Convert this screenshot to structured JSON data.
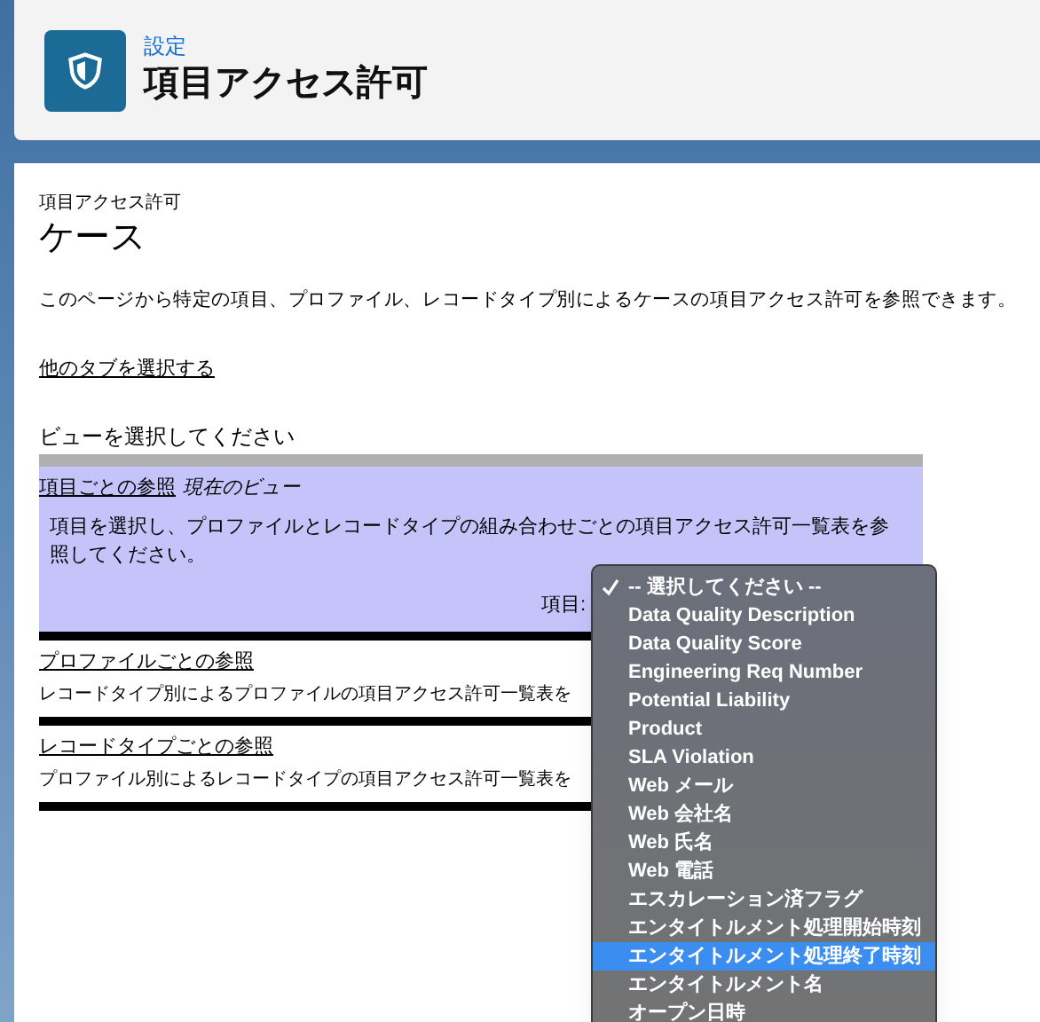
{
  "header": {
    "breadcrumb": "設定",
    "title": "項目アクセス許可"
  },
  "page": {
    "subtitle": "項目アクセス許可",
    "title": "ケース",
    "description": "このページから特定の項目、プロファイル、レコードタイプ別によるケースの項目アクセス許可を参照できます。",
    "tab_link": "他のタブを選択する",
    "view_prompt": "ビューを選択してください"
  },
  "views": [
    {
      "link": "項目ごとの参照",
      "current_label": "現在のビュー",
      "selected": true,
      "description": "項目を選択し、プロファイルとレコードタイプの組み合わせごとの項目アクセス許可一覧表を参照してください。",
      "field_label": "項目:"
    },
    {
      "link": "プロファイルごとの参照",
      "selected": false,
      "description": "レコードタイプ別によるプロファイルの項目アクセス許可一覧表を"
    },
    {
      "link": "レコードタイプごとの参照",
      "selected": false,
      "description": "プロファイル別によるレコードタイプの項目アクセス許可一覧表を"
    }
  ],
  "dropdown": {
    "options": [
      {
        "label": "-- 選択してください --",
        "checked": true,
        "highlighted": false
      },
      {
        "label": "Data Quality Description",
        "checked": false,
        "highlighted": false
      },
      {
        "label": "Data Quality Score",
        "checked": false,
        "highlighted": false
      },
      {
        "label": "Engineering Req Number",
        "checked": false,
        "highlighted": false
      },
      {
        "label": "Potential Liability",
        "checked": false,
        "highlighted": false
      },
      {
        "label": "Product",
        "checked": false,
        "highlighted": false
      },
      {
        "label": "SLA Violation",
        "checked": false,
        "highlighted": false
      },
      {
        "label": "Web メール",
        "checked": false,
        "highlighted": false
      },
      {
        "label": "Web 会社名",
        "checked": false,
        "highlighted": false
      },
      {
        "label": "Web 氏名",
        "checked": false,
        "highlighted": false
      },
      {
        "label": "Web 電話",
        "checked": false,
        "highlighted": false
      },
      {
        "label": "エスカレーション済フラグ",
        "checked": false,
        "highlighted": false
      },
      {
        "label": "エンタイトルメント処理開始時刻",
        "checked": false,
        "highlighted": false
      },
      {
        "label": "エンタイトルメント処理終了時刻",
        "checked": false,
        "highlighted": true
      },
      {
        "label": "エンタイトルメント名",
        "checked": false,
        "highlighted": false
      },
      {
        "label": "オープン日時",
        "checked": false,
        "highlighted": false
      }
    ]
  }
}
